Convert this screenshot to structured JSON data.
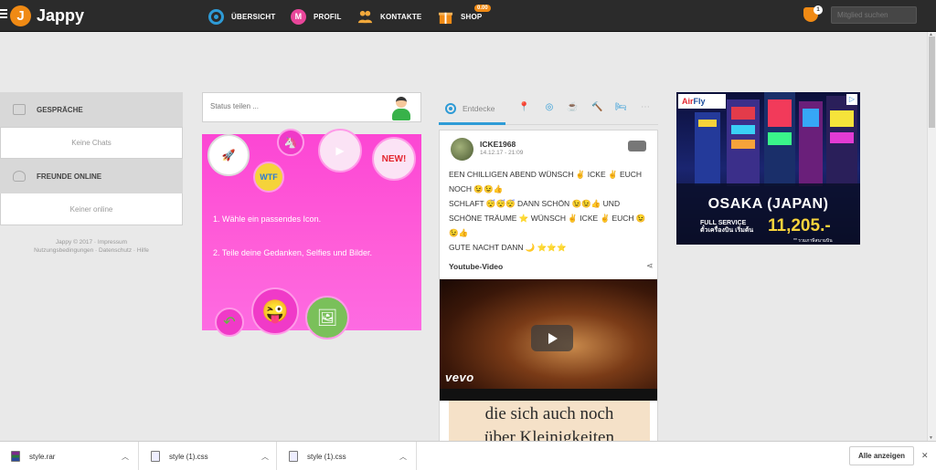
{
  "brand": {
    "logo_letter": "J",
    "name": "Jappy"
  },
  "nav": {
    "items": [
      {
        "label": "ÜBERSICHT"
      },
      {
        "label": "PROFIL",
        "icon_letter": "M"
      },
      {
        "label": "KONTAKTE"
      },
      {
        "label": "SHOP",
        "badge": "0.00"
      }
    ],
    "notification_count": "1",
    "member_search_placeholder": "Mitglied suchen"
  },
  "sidebar": {
    "chats_heading": "GESPRÄCHE",
    "chats_empty": "Keine Chats",
    "friends_heading": "FREUNDE ONLINE",
    "friends_empty": "Keiner online",
    "footer_line1": "Jappy © 2017 · Impressum",
    "footer_line2": "Nutzungsbedingungen · Datenschutz · Hilfe"
  },
  "status": {
    "placeholder": "Status teilen ...",
    "step1": "1. Wähle ein passendes Icon.",
    "step2": "2. Teile deine Gedanken, Selfies und Bilder."
  },
  "feed": {
    "tab_label": "Entdecke",
    "post": {
      "user": "ICKE1968",
      "time": "14.12.17 - 21:09",
      "lines": [
        "EEN CHILLIGEN ABEND WÜNSCH ✌ ICKE ✌ EUCH",
        "NOCH 😉😉👍",
        "SCHLAFT 😴😴😴 DANN SCHÖN 😉😉👍 UND",
        "SCHÖNE TRÄUME ⭐ WÜNSCH ✌ ICKE ✌ EUCH 😉",
        "😉👍",
        "GUTE NACHT DANN 🌙 ⭐⭐⭐"
      ],
      "media_label": "Youtube-Video",
      "video_brand": "vevo",
      "quote_line1": "die sich auch noch",
      "quote_line2": "über Kleinigkeiten"
    }
  },
  "ad": {
    "logo_a": "Air",
    "logo_b": "Fly",
    "title": "OSAKA (JAPAN)",
    "service": "FULL SERVICE",
    "service_sub": "ตั๋วเครื่องบิน เริ่มต้น",
    "price": "11,205.-",
    "note": "** รวมภาษีสนามบิน"
  },
  "downloads": {
    "items": [
      {
        "name": "style.rar"
      },
      {
        "name": "style (1).css"
      },
      {
        "name": "style (1).css"
      }
    ],
    "show_all": "Alle anzeigen"
  },
  "colors": {
    "topbar": "#2b2b2b",
    "accent_orange": "#f08a14",
    "accent_blue": "#2e9bd6",
    "promo_pink": "#fc46d4"
  }
}
